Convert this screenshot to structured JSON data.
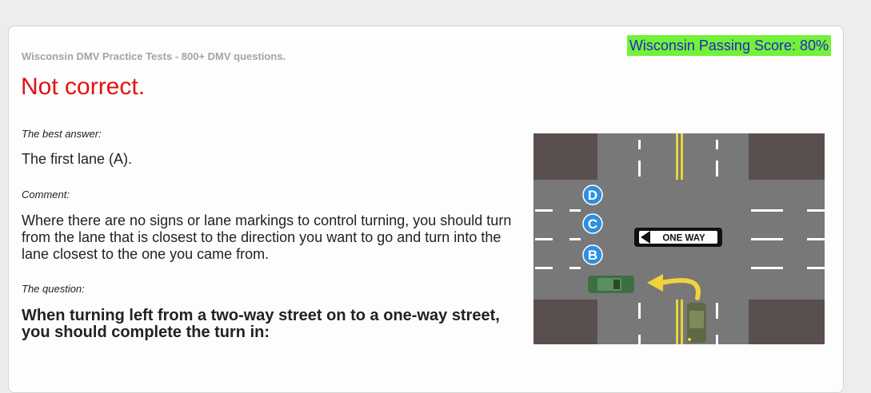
{
  "header": {
    "passing_score": "Wisconsin Passing Score: 80%",
    "site_title": "Wisconsin DMV Practice Tests - 800+ DMV questions."
  },
  "result": {
    "status": "Not correct.",
    "status_color": "#e41010"
  },
  "best_answer": {
    "label": "The best answer:",
    "text": "The first lane (A)."
  },
  "comment": {
    "label": "Comment:",
    "text": "Where there are no signs or lane markings to control turning, you should turn from the lane that is closest to the direction you want to go and turn into the lane closest to the one you came from."
  },
  "question": {
    "label": "The question:",
    "text": "When turning left from a two-way street on to a one-way street, you should complete the turn in:"
  },
  "illustration": {
    "lane_labels": [
      "D",
      "C",
      "B"
    ],
    "sign_text": "ONE WAY"
  }
}
